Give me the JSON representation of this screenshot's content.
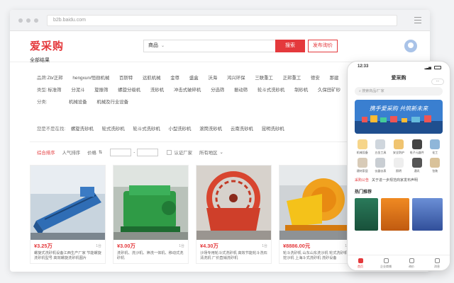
{
  "browser": {
    "url": "b2b.baidu.com"
  },
  "header": {
    "logo": "爱采购",
    "search_category": "商品",
    "search_button": "搜索",
    "quote_button": "发布询价"
  },
  "breadcrumb": "全部结果",
  "filters": [
    {
      "label": "品牌:",
      "options": [
        "Zb/正邦",
        "hengxun/恒勋机械",
        "百斯特",
        "远航机械",
        "金尊",
        "盛盒",
        "沃海",
        "鸿兴环保",
        "三联重工",
        "正邦重工",
        "德安",
        "那建",
        "富林"
      ]
    },
    {
      "label": "类型:",
      "options": [
        "标准筛",
        "分泥斗",
        "旋振筛",
        "螺旋分级机",
        "洗砂机",
        "冲击式破碎机",
        "分选筛",
        "振动筛",
        "轮斗式洗砂机",
        "制砂机",
        "久保田矿砂"
      ]
    },
    {
      "label": "分类:",
      "options": [
        "机械设备",
        "机械及行业设备"
      ]
    }
  ],
  "also_search": {
    "label": "您是不是在找:",
    "items": [
      "螺旋洗砂机",
      "轮式洗砂机",
      "轮斗式洗砂机",
      "小型洗砂机",
      "滚筒洗砂机",
      "云南洗砂机",
      "昆明洗砂机"
    ]
  },
  "sortbar": {
    "default": "综合排序",
    "popular": "人气排序",
    "price": "价格",
    "certified": "认证厂家",
    "region": "所有地区"
  },
  "products": [
    {
      "price": "¥3.25万",
      "tag": "1台",
      "desc": "螺旋式洗砂机设备江西生产厂家 节能螺旋洗砂机型号 高效螺旋洗砂机图片"
    },
    {
      "price": "¥3.00万",
      "tag": "1台",
      "desc": "洗砂机、洗沙机、筛洗一体机、移动式洗砂机"
    },
    {
      "price": "¥4.30万",
      "tag": "1台",
      "desc": "沙场专用轮斗式洗砂机 高效节能轮斗洗石清洗机 厂价直销洗砂机"
    },
    {
      "price": "¥8886.00元",
      "tag": "1台",
      "desc": "轮斗洗砂机 山东山东洗沙机 轮式洗砂机 挖沙机 上海斗式洗砂机 洗砂设备"
    }
  ],
  "phone": {
    "time": "12:33",
    "title": "爱采购",
    "search_placeholder": "搜索商品/厂家",
    "banner_text": "携手爱采购 共筑新未来",
    "categories": [
      "机械设备",
      "五金工具",
      "安全防护",
      "电子元器件",
      "化工",
      "建材家居",
      "仪器仪表",
      "照明",
      "通讯",
      "包装"
    ],
    "notice_tag": "采购公告",
    "notice_text": "关于进一步规范商家发布声明",
    "hot_title": "热门推荐",
    "tabs": [
      "首页",
      "企业商铺",
      "询价",
      "消息"
    ]
  },
  "colors": {
    "brand_red": "#e4393c"
  }
}
